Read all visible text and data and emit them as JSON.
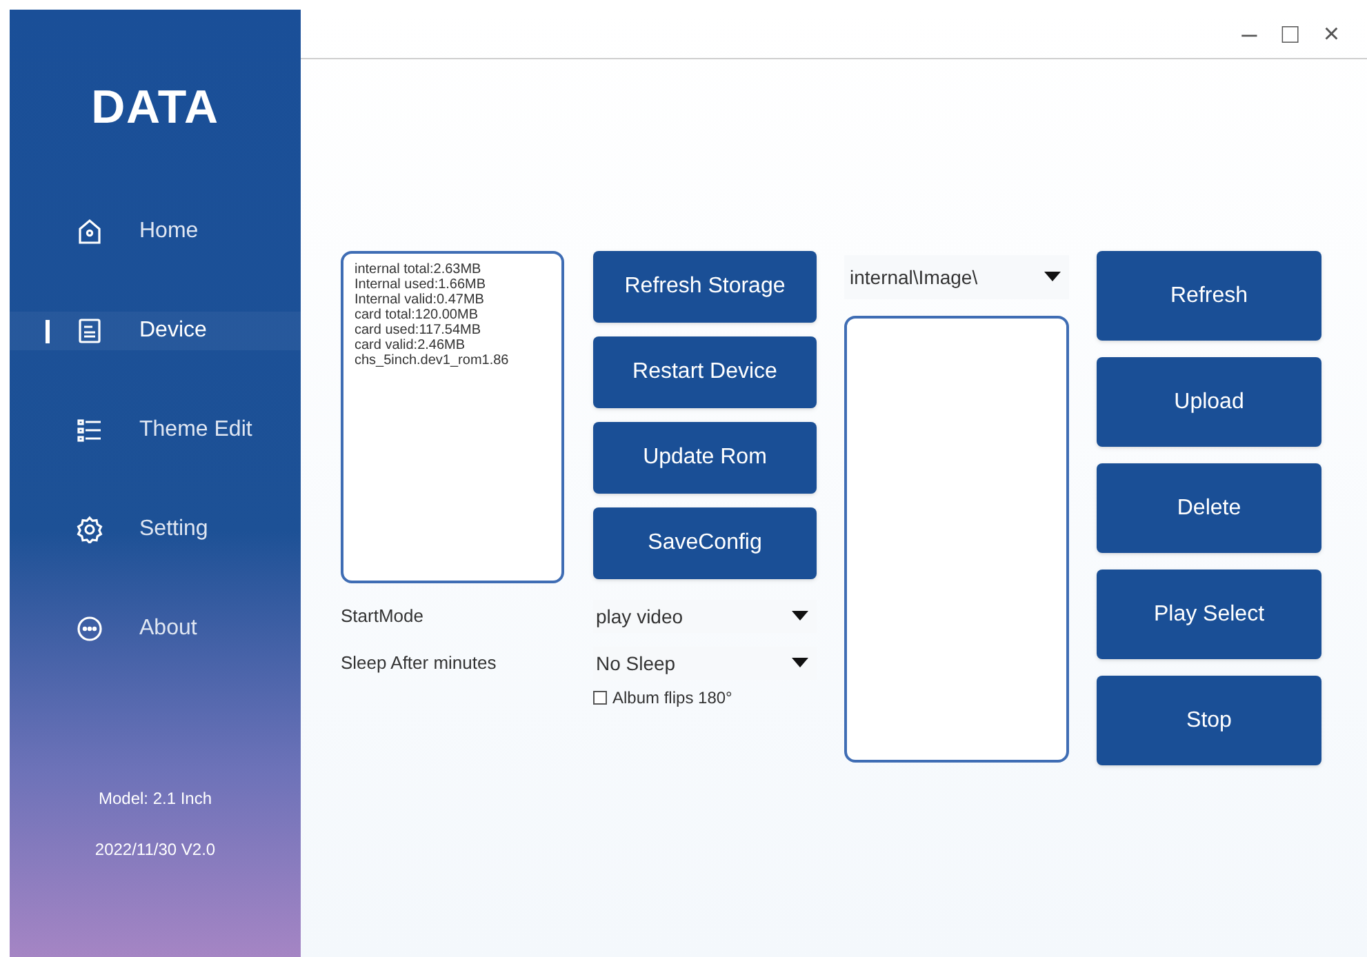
{
  "window": {
    "controls": [
      "–",
      "□",
      "×"
    ]
  },
  "sidebar": {
    "title": "DATA",
    "items": [
      {
        "label": "Home",
        "kind": "home",
        "selected": false
      },
      {
        "label": "Device",
        "kind": "device",
        "selected": true
      },
      {
        "label": "Theme Edit",
        "kind": "list",
        "selected": false
      },
      {
        "label": "Setting",
        "kind": "gear",
        "selected": false
      },
      {
        "label": "About",
        "kind": "dots",
        "selected": false
      }
    ],
    "model": "Model: 2.1 Inch",
    "version": "2022/11/30 V2.0"
  },
  "storage_info": [
    "internal total:2.63MB",
    "Internal used:1.66MB",
    "Internal valid:0.47MB",
    "card total:120.00MB",
    "card used:117.54MB",
    "card valid:2.46MB",
    "chs_5inch.dev1_rom1.86"
  ],
  "device_buttons": [
    "Refresh Storage",
    "Restart Device",
    "Update Rom",
    "SaveConfig"
  ],
  "settings": [
    {
      "label": "StartMode",
      "value": "play video"
    },
    {
      "label": "Sleep After minutes",
      "value": "No Sleep"
    }
  ],
  "album_flip": {
    "label": "Album flips 180°",
    "checked": false
  },
  "folder": {
    "value": "internal\\Image\\"
  },
  "file_buttons": [
    "Refresh",
    "Upload",
    "Delete",
    "Play Select",
    "Stop"
  ]
}
